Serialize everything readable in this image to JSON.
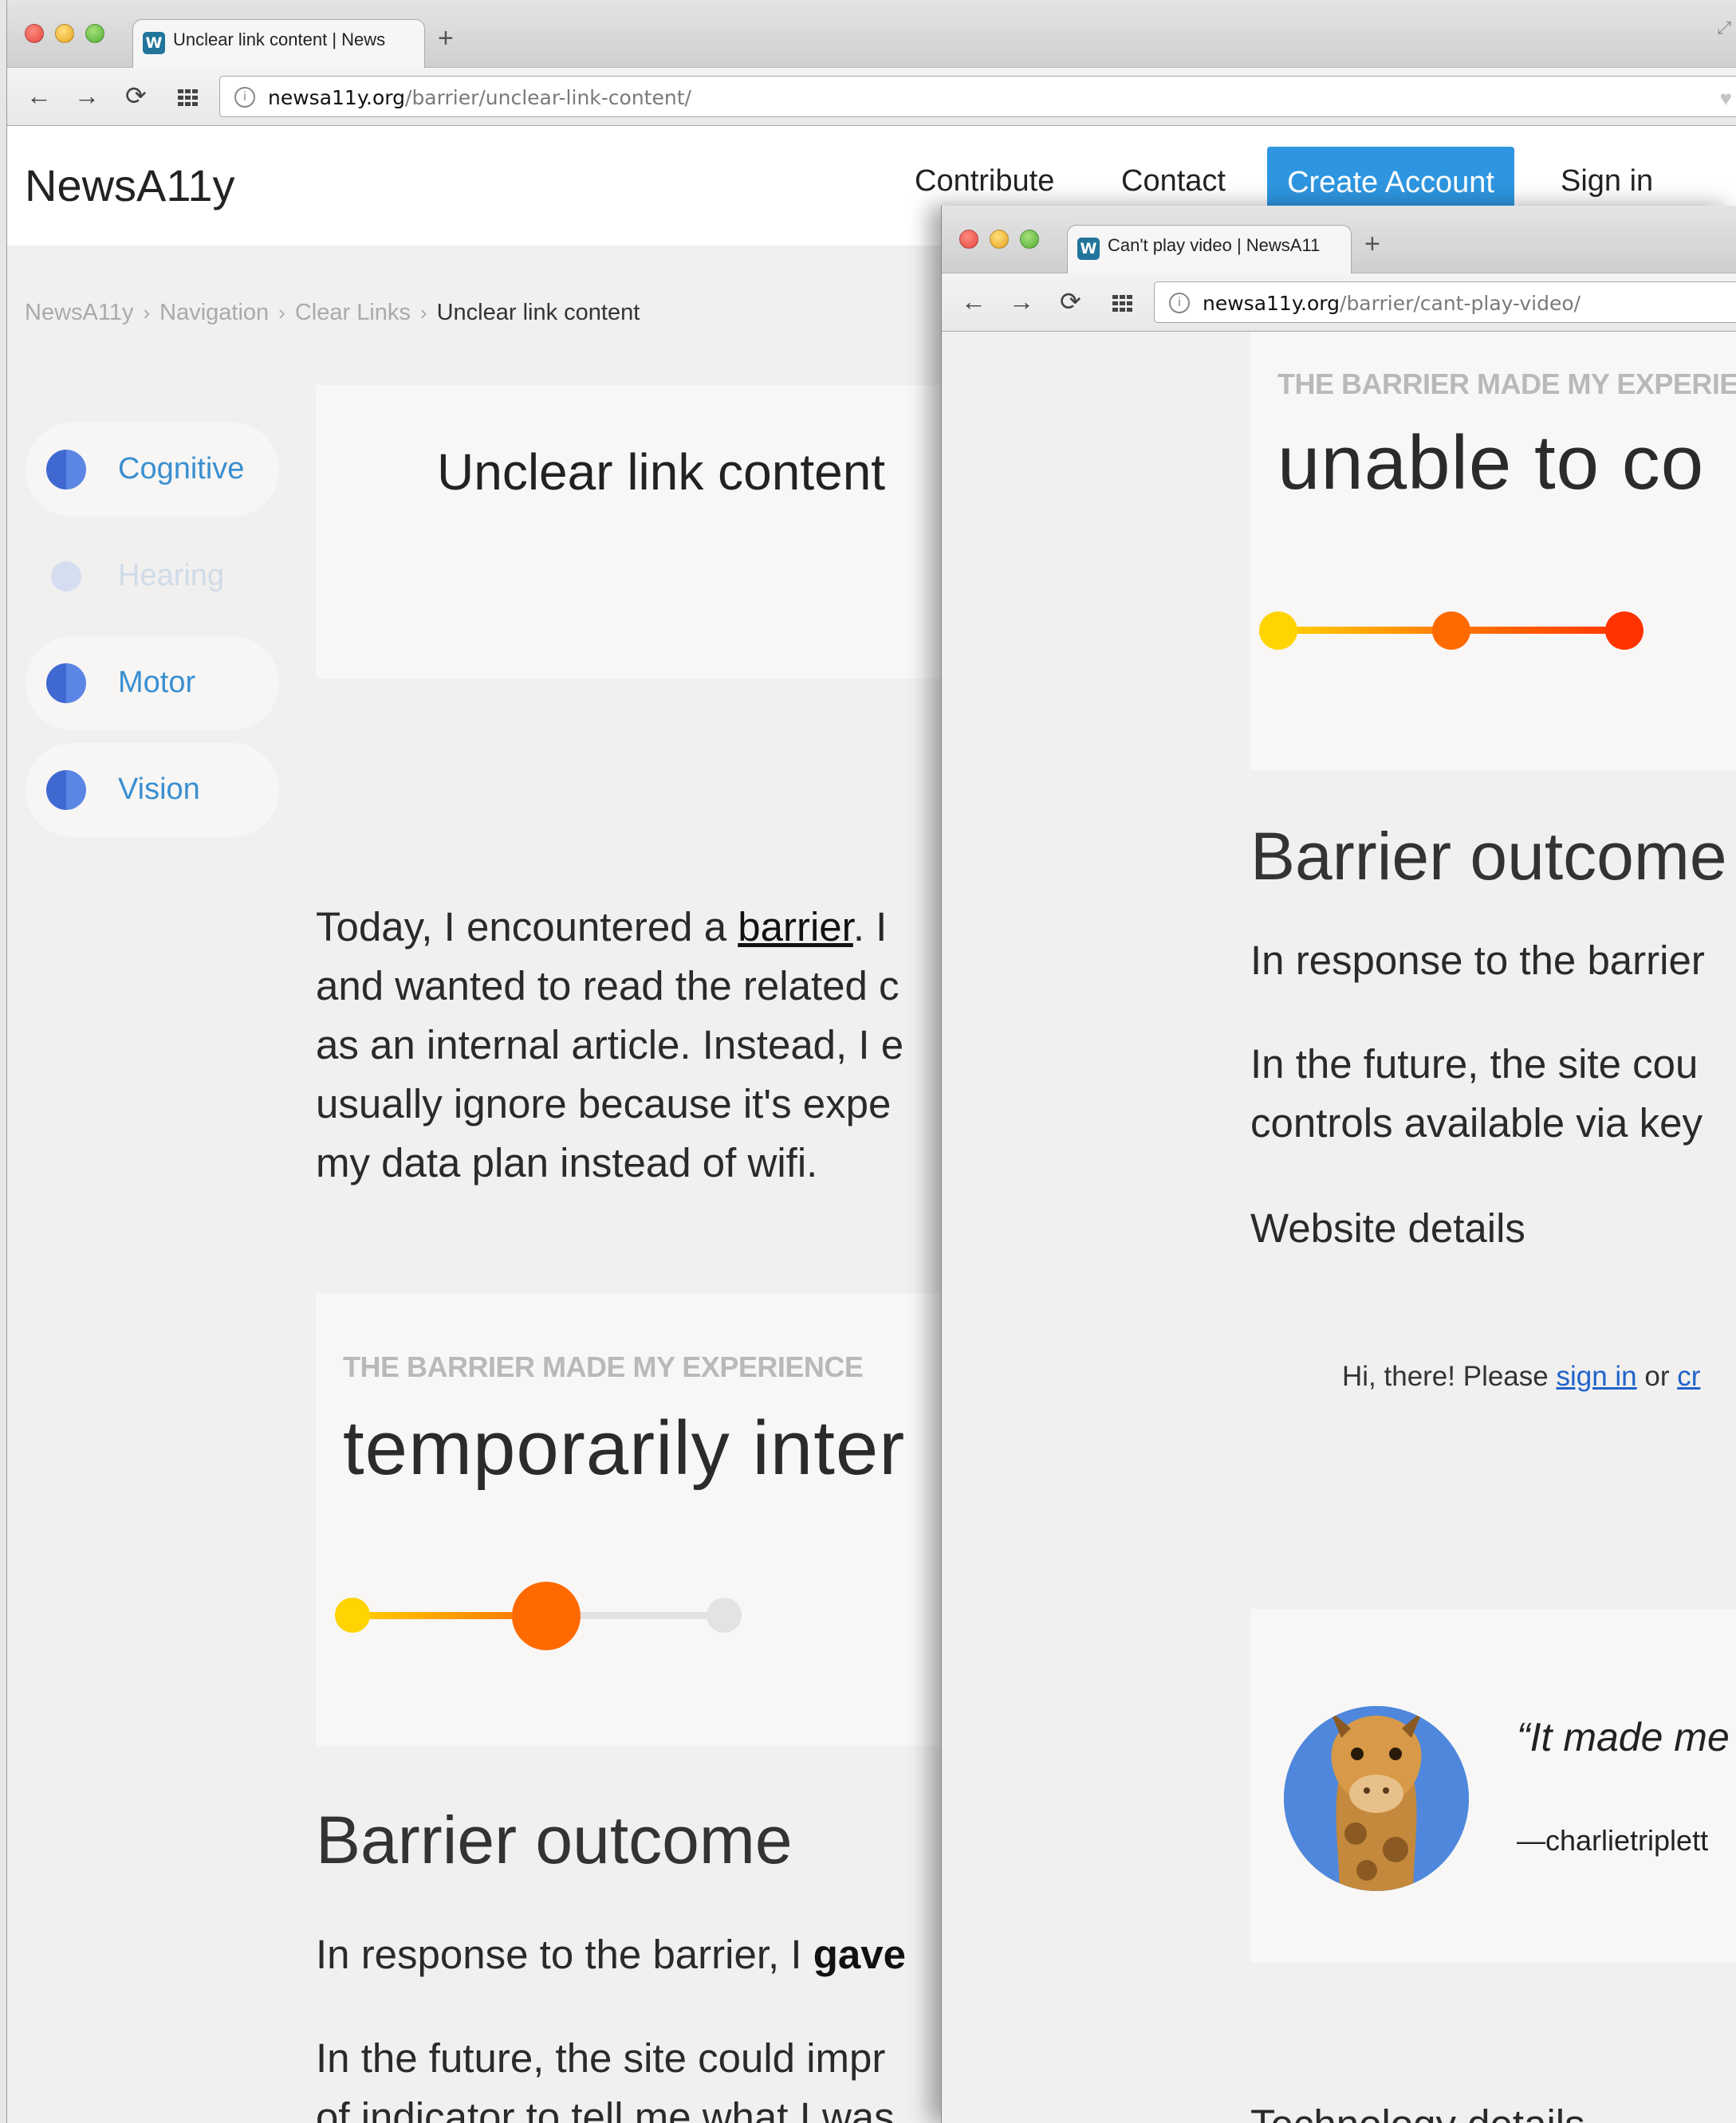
{
  "colors": {
    "accent": "#2e96e0",
    "link": "#3a8fd0",
    "scale_low": "#ffd400",
    "scale_mid": "#ff6a00",
    "scale_high": "#ff3300"
  },
  "window1": {
    "tab_title": "Unclear link content | News",
    "url_domain": "newsa11y.org",
    "url_path": "/barrier/unclear-link-content/",
    "site": {
      "logo": "NewsA11y",
      "nav": {
        "contribute": "Contribute",
        "contact": "Contact",
        "create_account": "Create Account",
        "sign_in": "Sign in"
      }
    },
    "breadcrumb": [
      {
        "label": "NewsA11y"
      },
      {
        "label": "Navigation"
      },
      {
        "label": "Clear Links"
      },
      {
        "label": "Unclear link content"
      }
    ],
    "breadcrumb_separator": "›",
    "sidebar": [
      {
        "label": "Cognitive",
        "state": "active"
      },
      {
        "label": "Hearing",
        "state": "faded"
      },
      {
        "label": "Motor",
        "state": "active"
      },
      {
        "label": "Vision",
        "state": "active"
      }
    ],
    "title": "Unclear link content",
    "story": {
      "line1_before": "Today, I encountered a ",
      "line1_link": "barrier",
      "line1_after": ". I",
      "line2": "and wanted to read the related c",
      "line3": "as an internal article. Instead, I e",
      "line4": "usually ignore because it's expe",
      "line5": "my data plan instead of wifi."
    },
    "experience": {
      "kicker": "THE BARRIER MADE MY EXPERIENCE",
      "value": "temporarily inter",
      "scale_level": "2 of 3"
    },
    "outcome": {
      "title": "Barrier outcome",
      "response_before": "In response to the barrier, I ",
      "response_bold": "gave",
      "future_line1": "In the future, the site could impr",
      "future_line2": "of indicator to tell me what I was"
    }
  },
  "window2": {
    "tab_title": "Can't play video | NewsA11",
    "url_domain": "newsa11y.org",
    "url_path": "/barrier/cant-play-video/",
    "experience": {
      "kicker": "THE BARRIER MADE MY EXPERIEN",
      "value": "unable to co",
      "scale_level": "3 of 3"
    },
    "outcome": {
      "title": "Barrier outcome",
      "response": "In response to the barrier",
      "future_line1": "In the future, the site cou",
      "future_line2": "controls available via key"
    },
    "website_details": "Website details",
    "login_note": {
      "before": "Hi, there! Please ",
      "sign_in": "sign in",
      "middle": " or ",
      "create": "cr"
    },
    "testimonial": {
      "quote": "“It made me",
      "author": "—charlietriplett"
    },
    "technology_details": "Technology details"
  }
}
